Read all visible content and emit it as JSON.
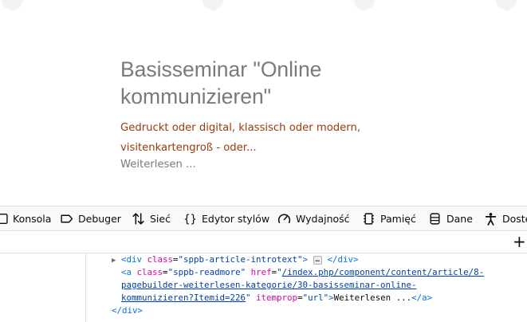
{
  "article": {
    "title": "Basisseminar \"Online kommunizieren\"",
    "intro": "Gedruckt oder digital, klassisch oder modern, visitenkartengroß - oder...",
    "readmore": "Weiterlesen ..."
  },
  "devtools": {
    "tabs": [
      {
        "label": "Konsola",
        "icon": "console-icon"
      },
      {
        "label": "Debuger",
        "icon": "debugger-icon"
      },
      {
        "label": "Sieć",
        "icon": "network-icon"
      },
      {
        "label": "Edytor stylów",
        "icon": "style-editor-icon"
      },
      {
        "label": "Wydajność",
        "icon": "performance-icon"
      },
      {
        "label": "Pamięć",
        "icon": "memory-icon"
      },
      {
        "label": "Dane",
        "icon": "storage-icon"
      },
      {
        "label": "Dostę",
        "icon": "accessibility-icon"
      }
    ],
    "add_button": "+",
    "markup": {
      "line1": {
        "open_tag": "<div",
        "attr": "class",
        "eq": "=",
        "value": "\"sppb-article-introtext\"",
        "close_bracket": ">",
        "ellipsis": "…",
        "end_tag": "</div>"
      },
      "line2": {
        "open_tag": "<a",
        "attr1": "class",
        "eq": "=",
        "value1": "\"sppb-readmore\"",
        "attr2": "href",
        "href_part1": "/index.php/component/content/article/8-",
        "quote": "\"",
        "href_part2": "pagebuilder-weiterlesen-kategorie/30-basisseminar-online-",
        "href_part3": "kommunizieren?Itemid=226",
        "attr3": "itemprop",
        "value3": "\"url\"",
        "close_bracket": ">",
        "text": "Weiterlesen ...",
        "end_tag": "</a>"
      },
      "line3": {
        "end_tag": "</div>"
      }
    }
  }
}
